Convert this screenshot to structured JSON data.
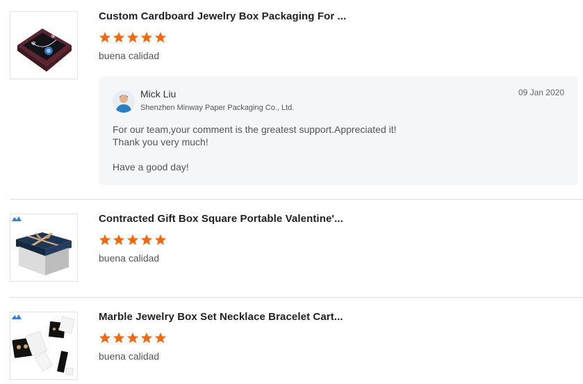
{
  "reviews": [
    {
      "product_title": "Custom Cardboard Jewelry Box Packaging For ...",
      "rating": 5,
      "comment": "buena calidad",
      "thumbnail_icon": "jewelry-box-necklace-image",
      "reply": {
        "name": "Mick Liu",
        "company": "Shenzhen Minway Paper Packaging Co., Ltd.",
        "date": "09 Jan 2020",
        "message_lines": [
          "For our team,your comment is the greatest support.Appreciated it!",
          "Thank you very much!",
          "Have a good day!"
        ]
      }
    },
    {
      "product_title": "Contracted Gift Box Square Portable Valentine'...",
      "rating": 5,
      "comment": "buena calidad",
      "thumbnail_icon": "gift-box-image"
    },
    {
      "product_title": "Marble Jewelry Box Set Necklace Bracelet Cart...",
      "rating": 5,
      "comment": "buena calidad",
      "thumbnail_icon": "marble-jewelry-box-set-image"
    }
  ],
  "colors": {
    "star": "#f26a10",
    "reply_bg": "#f5f6f8",
    "divider": "#dedede"
  }
}
